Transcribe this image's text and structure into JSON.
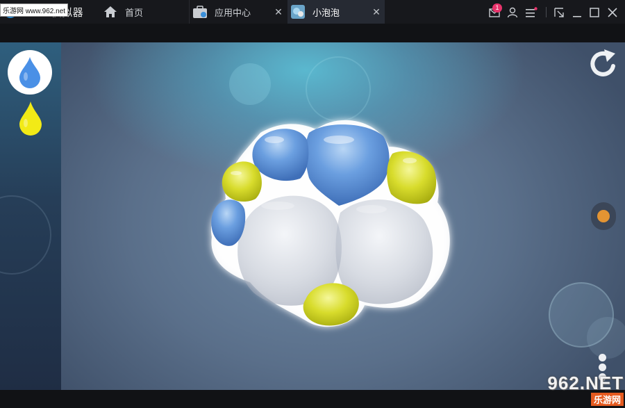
{
  "watermark_top": "乐游网 www.962.net",
  "app": {
    "name": "MuMu模拟器"
  },
  "tabs": [
    {
      "label": "首页",
      "icon": "home-icon",
      "closable": false,
      "active": false
    },
    {
      "label": "应用中心",
      "icon": "app-center-icon",
      "closable": true,
      "active": false
    },
    {
      "label": "小泡泡",
      "icon": "game-icon",
      "closable": true,
      "active": true
    }
  ],
  "window_controls": {
    "message_badge": "1",
    "icons": [
      "mail-icon",
      "user-icon",
      "menu-icon",
      "shrink-icon",
      "minimize-icon",
      "maximize-icon",
      "close-icon"
    ]
  },
  "game": {
    "selected_drop_color": "#4a90e6",
    "next_drop_color": "#f2ea16",
    "side_button_color": "#e39433",
    "bubble_colors": {
      "blue": "#5f93d8",
      "yellow": "#d6da2c",
      "clear": "#c9ced6"
    }
  },
  "watermark_bottom": {
    "big": "962.NET",
    "small": "乐游网"
  }
}
